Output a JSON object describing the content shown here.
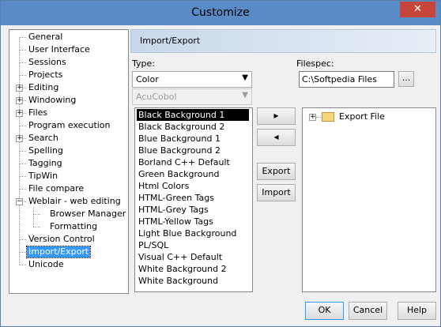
{
  "window": {
    "title": "Customize",
    "close_glyph": "✕"
  },
  "tree": {
    "items": [
      {
        "label": "General",
        "level": 0
      },
      {
        "label": "User Interface",
        "level": 0
      },
      {
        "label": "Sessions",
        "level": 0
      },
      {
        "label": "Projects",
        "level": 0
      },
      {
        "label": "Editing",
        "level": 0,
        "expandable": true
      },
      {
        "label": "Windowing",
        "level": 0,
        "expandable": true
      },
      {
        "label": "Files",
        "level": 0,
        "expandable": true
      },
      {
        "label": "Program execution",
        "level": 0
      },
      {
        "label": "Search",
        "level": 0,
        "expandable": true
      },
      {
        "label": "Spelling",
        "level": 0
      },
      {
        "label": "Tagging",
        "level": 0
      },
      {
        "label": "TipWin",
        "level": 0
      },
      {
        "label": "File compare",
        "level": 0
      },
      {
        "label": "Weblair - web editing",
        "level": 0,
        "expanded": true
      },
      {
        "label": "Browser Manager",
        "level": 1
      },
      {
        "label": "Formatting",
        "level": 1
      },
      {
        "label": "Version Control",
        "level": 0
      },
      {
        "label": "Import/Export",
        "level": 0,
        "selected": true
      },
      {
        "label": "Unicode",
        "level": 0
      }
    ]
  },
  "panel": {
    "header": "Import/Export",
    "type_label": "Type:",
    "type_value": "Color",
    "subtype_value": "AcuCobol",
    "filespec_label": "Filespec:",
    "filespec_value": "C:\\Softpedia Files",
    "browse_label": "...",
    "schemes": [
      "Black Background 1",
      "Black Background 2",
      "Blue Background 1",
      "Blue Background 2",
      "Borland C++ Default",
      "Green Background",
      "Html Colors",
      "HTML-Green Tags",
      "HTML-Grey Tags",
      "HTML-Yellow Tags",
      "Light Blue Background",
      "PL/SQL",
      "Visual C++ Default",
      "White Background 2",
      "White Background"
    ],
    "selected_scheme_index": 0,
    "move_right_glyph": "▸",
    "move_left_glyph": "◂",
    "export_label": "Export",
    "import_label": "Import",
    "export_file_label": "Export File",
    "expand_glyph": "+"
  },
  "footer": {
    "ok_label": "OK",
    "cancel_label": "Cancel",
    "help_label": "Help"
  }
}
